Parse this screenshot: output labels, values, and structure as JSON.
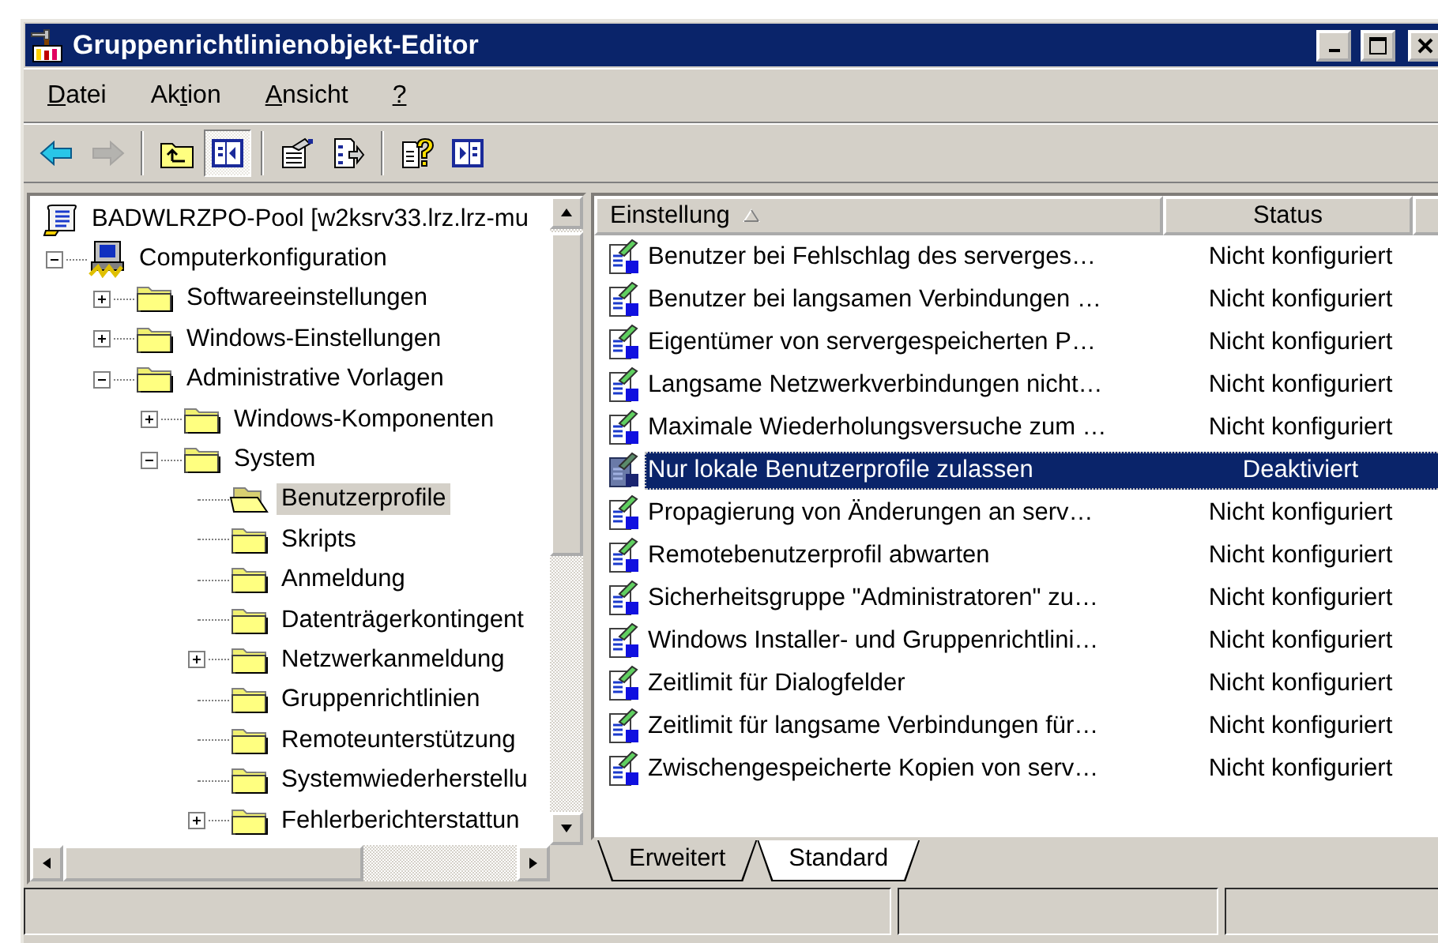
{
  "window": {
    "title": "Gruppenrichtlinienobjekt-Editor"
  },
  "menu": [
    {
      "access_key": "D",
      "after": "atei"
    },
    {
      "before": "Ak",
      "access_key": "t",
      "after": "ion"
    },
    {
      "access_key": "A",
      "after": "nsicht"
    },
    {
      "access_key": "?"
    }
  ],
  "toolbar": [
    {
      "kind": "button",
      "disabled": false,
      "pressed": false
    },
    {
      "kind": "button",
      "disabled": true,
      "pressed": false
    },
    {
      "kind": "separator"
    },
    {
      "kind": "button",
      "disabled": false,
      "pressed": false
    },
    {
      "kind": "button",
      "disabled": false,
      "pressed": true
    },
    {
      "kind": "separator"
    },
    {
      "kind": "button",
      "disabled": false,
      "pressed": false
    },
    {
      "kind": "button",
      "disabled": false,
      "pressed": false
    },
    {
      "kind": "separator"
    },
    {
      "kind": "button",
      "disabled": false,
      "pressed": false
    },
    {
      "kind": "button",
      "disabled": false,
      "pressed": false
    }
  ],
  "tree": {
    "items": [
      {
        "label": "BADWLRZPO-Pool [w2ksrv33.lrz.lrz-mu",
        "kind": "root",
        "selected": false,
        "children": [
          {
            "label": "Computerkonfiguration",
            "kind": "computer",
            "selected": false,
            "expanded": true,
            "children": [
              {
                "label": "Softwareeinstellungen",
                "kind": "folder",
                "selected": false,
                "expanded": false
              },
              {
                "label": "Windows-Einstellungen",
                "kind": "folder",
                "selected": false,
                "expanded": false
              },
              {
                "label": "Administrative Vorlagen",
                "kind": "folder",
                "selected": false,
                "expanded": true,
                "children": [
                  {
                    "label": "Windows-Komponenten",
                    "kind": "folder",
                    "selected": false,
                    "expanded": false
                  },
                  {
                    "label": "System",
                    "kind": "folder",
                    "selected": false,
                    "expanded": true,
                    "children": [
                      {
                        "label": "Benutzerprofile",
                        "kind": "folder",
                        "selected": true
                      },
                      {
                        "label": "Skripts",
                        "kind": "folder",
                        "selected": false
                      },
                      {
                        "label": "Anmeldung",
                        "kind": "folder",
                        "selected": false
                      },
                      {
                        "label": "Datenträgerkontingent",
                        "kind": "folder",
                        "selected": false
                      },
                      {
                        "label": "Netzwerkanmeldung",
                        "kind": "folder",
                        "selected": false,
                        "expanded": false
                      },
                      {
                        "label": "Gruppenrichtlinien",
                        "kind": "folder",
                        "selected": false
                      },
                      {
                        "label": "Remoteunterstützung",
                        "kind": "folder",
                        "selected": false
                      },
                      {
                        "label": "Systemwiederherstellu",
                        "kind": "folder",
                        "selected": false
                      },
                      {
                        "label": "Fehlerberichterstattun",
                        "kind": "folder",
                        "selected": false,
                        "expanded": false
                      }
                    ]
                  }
                ]
              }
            ]
          }
        ]
      }
    ]
  },
  "list": {
    "columns": [
      {
        "label": "Einstellung",
        "sorted": true
      },
      {
        "label": "Status",
        "sorted": false
      }
    ],
    "rows": [
      {
        "name": "Benutzer bei Fehlschlag des serverges…",
        "status": "Nicht konfiguriert",
        "selected": false
      },
      {
        "name": "Benutzer bei langsamen Verbindungen …",
        "status": "Nicht konfiguriert",
        "selected": false
      },
      {
        "name": "Eigentümer von servergespeicherten P…",
        "status": "Nicht konfiguriert",
        "selected": false
      },
      {
        "name": "Langsame Netzwerkverbindungen nicht…",
        "status": "Nicht konfiguriert",
        "selected": false
      },
      {
        "name": "Maximale Wiederholungsversuche zum …",
        "status": "Nicht konfiguriert",
        "selected": false
      },
      {
        "name": "Nur lokale Benutzerprofile zulassen",
        "status": "Deaktiviert",
        "selected": true
      },
      {
        "name": "Propagierung von Änderungen an serv…",
        "status": "Nicht konfiguriert",
        "selected": false
      },
      {
        "name": "Remotebenutzerprofil abwarten",
        "status": "Nicht konfiguriert",
        "selected": false
      },
      {
        "name": "Sicherheitsgruppe \"Administratoren\" zu…",
        "status": "Nicht konfiguriert",
        "selected": false
      },
      {
        "name": "Windows Installer- und Gruppenrichtlini…",
        "status": "Nicht konfiguriert",
        "selected": false
      },
      {
        "name": "Zeitlimit für Dialogfelder",
        "status": "Nicht konfiguriert",
        "selected": false
      },
      {
        "name": "Zeitlimit für langsame Verbindungen für…",
        "status": "Nicht konfiguriert",
        "selected": false
      },
      {
        "name": "Zwischengespeicherte Kopien von serv…",
        "status": "Nicht konfiguriert",
        "selected": false
      }
    ]
  },
  "tabs": [
    {
      "label": "Erweitert",
      "selected": false
    },
    {
      "label": "Standard",
      "selected": true
    }
  ]
}
